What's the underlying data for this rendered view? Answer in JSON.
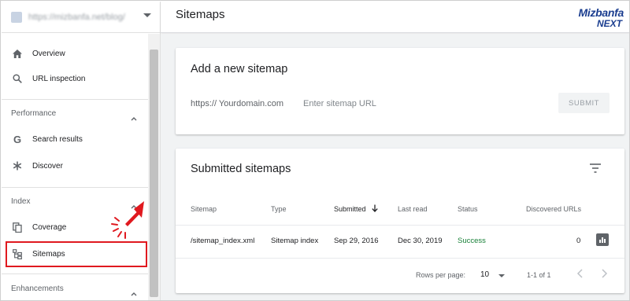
{
  "sidebar": {
    "property_url": "https://mizbanfa.net/blog/",
    "items": {
      "overview": "Overview",
      "url_inspection": "URL inspection",
      "search_results": "Search results",
      "discover": "Discover",
      "coverage": "Coverage",
      "sitemaps": "Sitemaps"
    },
    "sections": {
      "performance": "Performance",
      "index": "Index",
      "enhancements": "Enhancements"
    },
    "highlight_color": "#e0191f"
  },
  "header": {
    "title": "Sitemaps",
    "brand_top": "Mizbanfa",
    "brand_bottom": "NEXT",
    "brand_color": "#1a3d8f"
  },
  "add_sitemap": {
    "title": "Add a new sitemap",
    "prefix": "https:// Yourdomain.com",
    "input_placeholder": "Enter sitemap URL",
    "input_value": "",
    "submit_label": "SUBMIT"
  },
  "submitted": {
    "title": "Submitted sitemaps",
    "columns": {
      "sitemap": "Sitemap",
      "type": "Type",
      "submitted": "Submitted",
      "last_read": "Last read",
      "status": "Status",
      "discovered": "Discovered URLs"
    },
    "rows": [
      {
        "sitemap": "/sitemap_index.xml",
        "type": "Sitemap index",
        "submitted": "Sep 29, 2016",
        "last_read": "Dec 30, 2019",
        "status": "Success",
        "discovered": "0"
      }
    ],
    "status_color": "#188038",
    "pagination": {
      "rows_per_page_label": "Rows per page:",
      "rows_per_page_value": "10",
      "range": "1-1 of 1"
    }
  }
}
